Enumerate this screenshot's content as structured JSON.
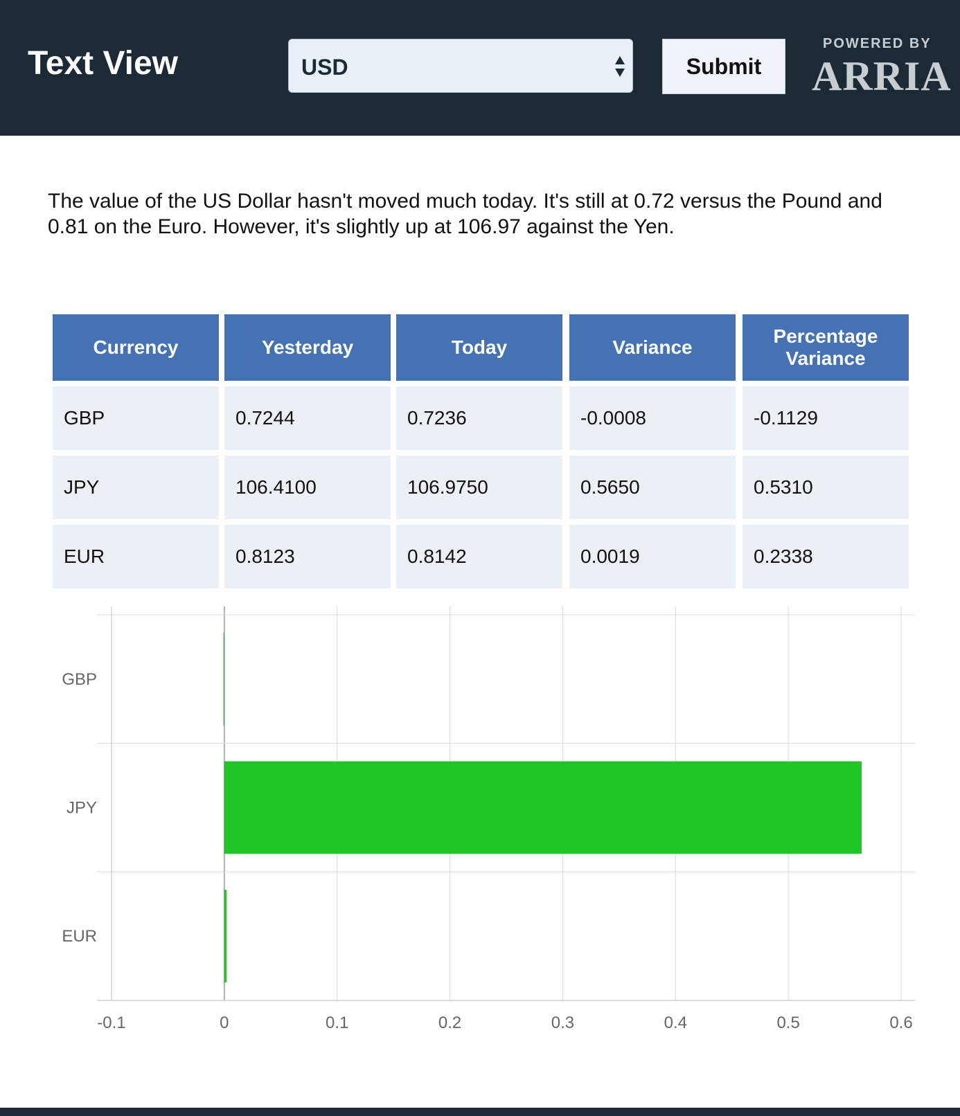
{
  "header": {
    "title": "Text View",
    "currency_select": {
      "value": "USD"
    },
    "submit_label": "Submit",
    "powered_by": "POWERED BY",
    "brand": "ARRIA",
    "background": "#1b2a35"
  },
  "summary": "The value of the US Dollar hasn't moved much today. It's still at 0.72 versus the Pound and 0.81 on the Euro. However, it's slightly up at 106.97 against the Yen.",
  "table": {
    "headers": [
      "Currency",
      "Yesterday",
      "Today",
      "Variance",
      "Percentage Variance"
    ],
    "rows": [
      [
        "GBP",
        "0.7244",
        "0.7236",
        "-0.0008",
        "-0.1129"
      ],
      [
        "JPY",
        "106.4100",
        "106.9750",
        "0.5650",
        "0.5310"
      ],
      [
        "EUR",
        "0.8123",
        "0.8142",
        "0.0019",
        "0.2338"
      ]
    ],
    "header_color": "#4472b3",
    "row_color": "#ebf0f7"
  },
  "chart_data": {
    "type": "bar",
    "orientation": "horizontal",
    "categories": [
      "GBP",
      "JPY",
      "EUR"
    ],
    "values": [
      -0.0008,
      0.565,
      0.0019
    ],
    "xlim": [
      -0.1,
      0.6
    ],
    "xticks": [
      "-0.1",
      "0",
      "0.1",
      "0.2",
      "0.3",
      "0.4",
      "0.5",
      "0.6"
    ],
    "bar_color": "#1fc624",
    "grid": true
  }
}
